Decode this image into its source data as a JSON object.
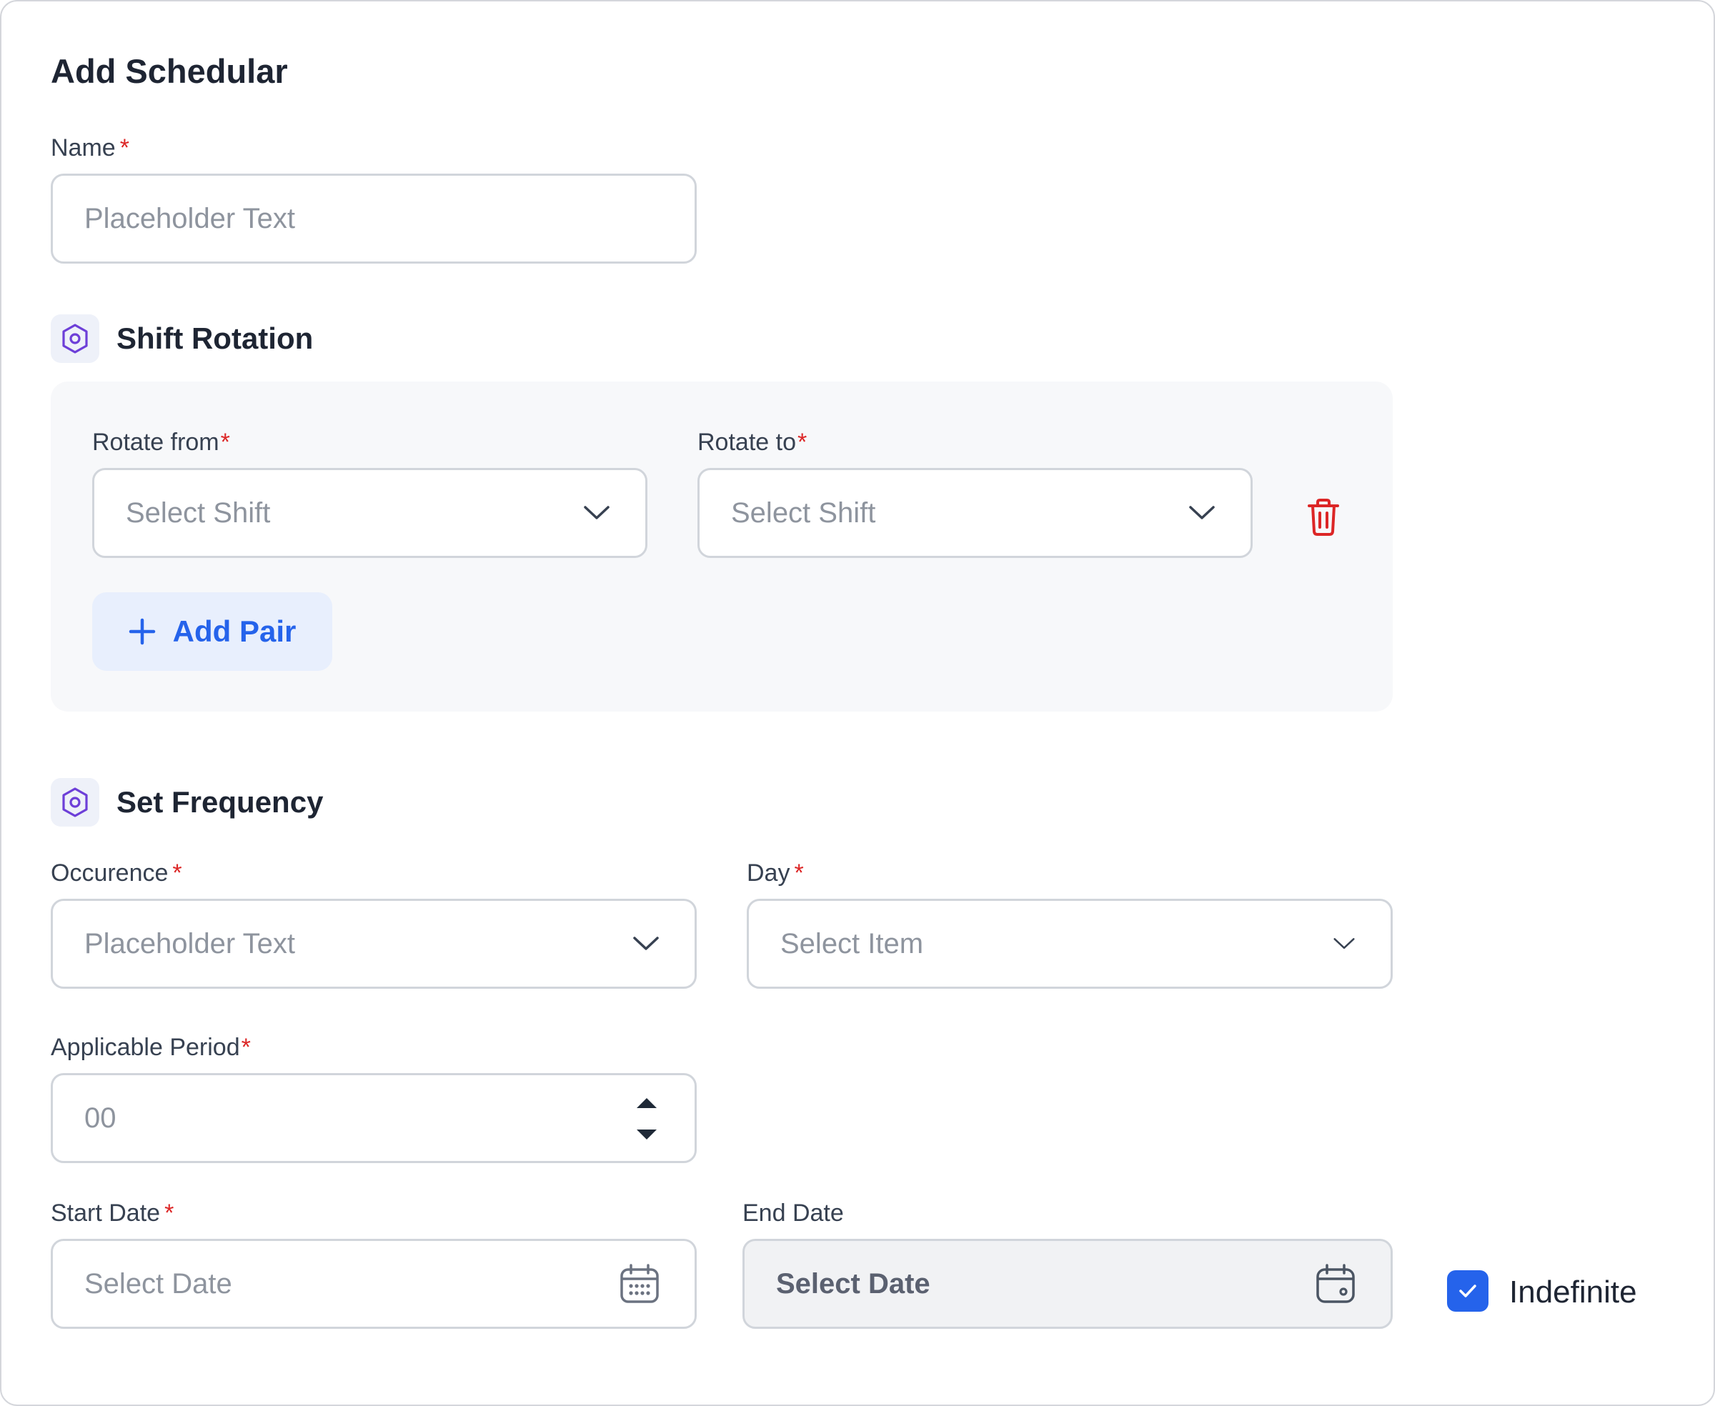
{
  "page": {
    "title": "Add Schedular"
  },
  "name_field": {
    "label": "Name",
    "required": "*",
    "placeholder": "Placeholder Text"
  },
  "shift_rotation": {
    "title": "Shift Rotation",
    "icon": "hexagon-settings-icon",
    "rotate_from": {
      "label": "Rotate from",
      "required": "*",
      "placeholder": "Select Shift"
    },
    "rotate_to": {
      "label": "Rotate to",
      "required": "*",
      "placeholder": "Select Shift"
    },
    "delete_icon": "trash-icon",
    "add_pair_label": "Add Pair"
  },
  "frequency": {
    "title": "Set Frequency",
    "icon": "hexagon-settings-icon",
    "occurence": {
      "label": "Occurence",
      "required": "*",
      "placeholder": "Placeholder Text"
    },
    "day": {
      "label": "Day",
      "required": "*",
      "placeholder": "Select Item"
    },
    "applicable_period": {
      "label": "Applicable Period",
      "required": "*",
      "placeholder": "00"
    },
    "start_date": {
      "label": "Start Date",
      "required": "*",
      "placeholder": "Select Date"
    },
    "end_date": {
      "label": "End Date",
      "placeholder": "Select Date"
    },
    "indefinite": {
      "label": "Indefinite",
      "checked": true
    }
  },
  "colors": {
    "accent": "#2563eb",
    "required": "#dc2626",
    "icon_purple": "#6d3fd8",
    "panel_bg": "#f7f8fa"
  }
}
